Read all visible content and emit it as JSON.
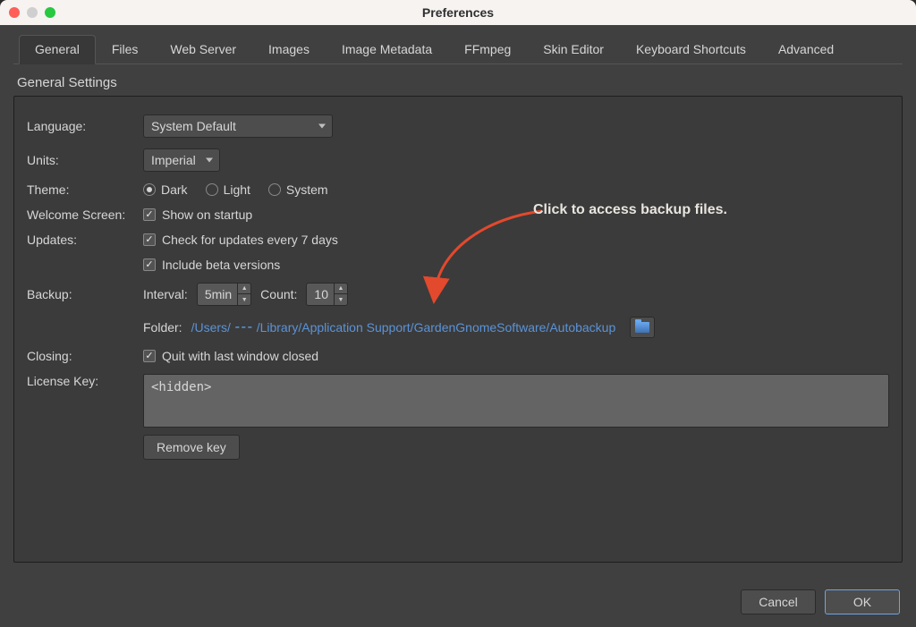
{
  "window": {
    "title": "Preferences"
  },
  "tabs": [
    {
      "label": "General",
      "active": true
    },
    {
      "label": "Files"
    },
    {
      "label": "Web Server"
    },
    {
      "label": "Images"
    },
    {
      "label": "Image Metadata"
    },
    {
      "label": "FFmpeg"
    },
    {
      "label": "Skin Editor"
    },
    {
      "label": "Keyboard Shortcuts"
    },
    {
      "label": "Advanced"
    }
  ],
  "section": {
    "title": "General Settings"
  },
  "labels": {
    "language": "Language:",
    "units": "Units:",
    "theme": "Theme:",
    "welcome": "Welcome Screen:",
    "updates": "Updates:",
    "backup": "Backup:",
    "interval": "Interval:",
    "count": "Count:",
    "folder": "Folder:",
    "closing": "Closing:",
    "license": "License Key:"
  },
  "values": {
    "language": "System Default",
    "units": "Imperial",
    "theme_dark": "Dark",
    "theme_light": "Light",
    "theme_system": "System",
    "welcome_show": "Show on startup",
    "updates_check": "Check for updates every 7 days",
    "updates_beta": "Include beta versions",
    "backup_interval": "5min",
    "backup_count": "10",
    "backup_folder": "/Users/ ⁃⁃⁃ /Library/Application Support/GardenGnomeSoftware/Autobackup",
    "closing_quit": "Quit with last window closed",
    "license_value": "<hidden>"
  },
  "buttons": {
    "remove_key": "Remove key",
    "cancel": "Cancel",
    "ok": "OK"
  },
  "annotation": {
    "text": "Click to access backup files."
  }
}
